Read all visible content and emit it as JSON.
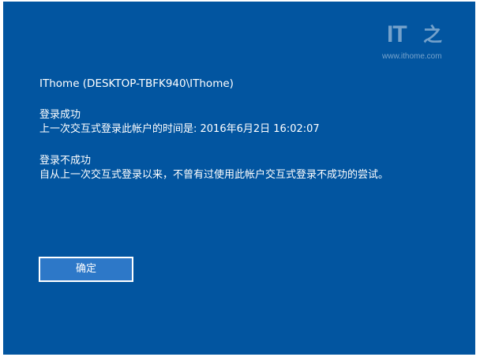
{
  "watermark": {
    "logo": "IT",
    "glyph": "之",
    "url": "www.ithome.com"
  },
  "account": "IThome (DESKTOP-TBFK940\\IThome)",
  "success": {
    "heading": "登录成功",
    "detail": "上一次交互式登录此帐户的时间是: 2016年6月2日 16:02:07"
  },
  "failure": {
    "heading": "登录不成功",
    "detail": "自从上一次交互式登录以来，不曾有过使用此帐户交互式登录不成功的尝试。"
  },
  "ok_button": "确定",
  "colors": {
    "background": "#0255a0",
    "button": "#2d78c8",
    "text": "#ffffff"
  }
}
